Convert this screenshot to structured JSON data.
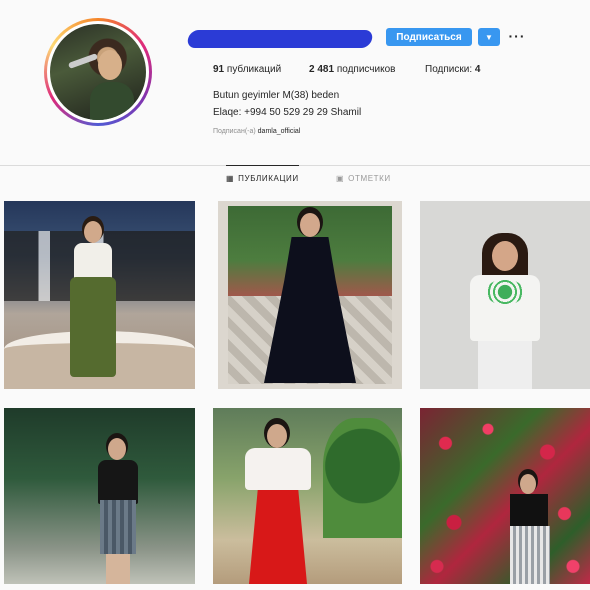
{
  "profile": {
    "follow_label": "Подписаться",
    "dropdown_glyph": "▼",
    "more_glyph": "···",
    "stats": {
      "posts_count": "91",
      "posts_label": "публикаций",
      "followers_count": "2 481",
      "followers_label": "подписчиков",
      "following_label": "Подписки:",
      "following_count": "4"
    },
    "bio_name": "Butun geyimler M(38) beden",
    "bio_contact": "Elaqe: +994 50 529 29 29 Shamil",
    "followed_by_prefix": "Подписан(-а)",
    "followed_by_account": "damla_official"
  },
  "tabs": [
    {
      "label": "ПУБЛИКАЦИИ",
      "icon": "grid-icon",
      "glyph": "▦",
      "active": true
    },
    {
      "label": "ОТМЕТКИ",
      "icon": "tag-icon",
      "glyph": "▣",
      "active": false
    }
  ],
  "colors": {
    "follow_button": "#3897f0",
    "redaction": "#2b3bd6",
    "background": "#fafafa"
  },
  "posts": [
    {
      "subject": "singer-on-stage"
    },
    {
      "subject": "black-gown"
    },
    {
      "subject": "embroidered-top"
    },
    {
      "subject": "plaid-skirt"
    },
    {
      "subject": "red-skirt"
    },
    {
      "subject": "flower-wall"
    }
  ]
}
